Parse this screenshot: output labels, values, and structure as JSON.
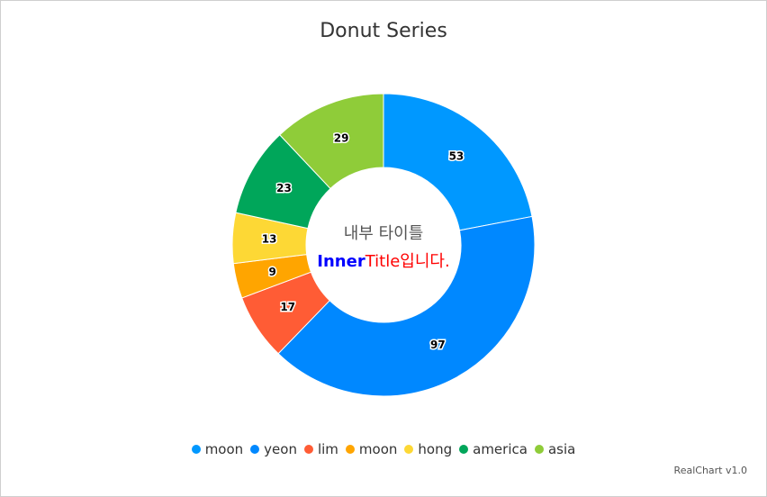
{
  "chart_data": {
    "type": "pie",
    "title": "Donut Series",
    "categories": [
      "moon",
      "yeon",
      "lim",
      "moon",
      "hong",
      "america",
      "asia"
    ],
    "values": [
      53,
      97,
      17,
      9,
      13,
      23,
      29
    ],
    "colors": [
      "#0098ff",
      "#0088ff",
      "#ff5c35",
      "#ffa500",
      "#fdd835",
      "#00a65a",
      "#8fcc39"
    ],
    "inner_title": "내부 타이틀",
    "inner_subtitle": {
      "part1": "Inner",
      "part2": "Title",
      "part3": "입니다."
    },
    "legend_position": "bottom",
    "start_angle_deg": 0,
    "direction": "clockwise",
    "donut": true
  },
  "credits": "RealChart v1.0"
}
